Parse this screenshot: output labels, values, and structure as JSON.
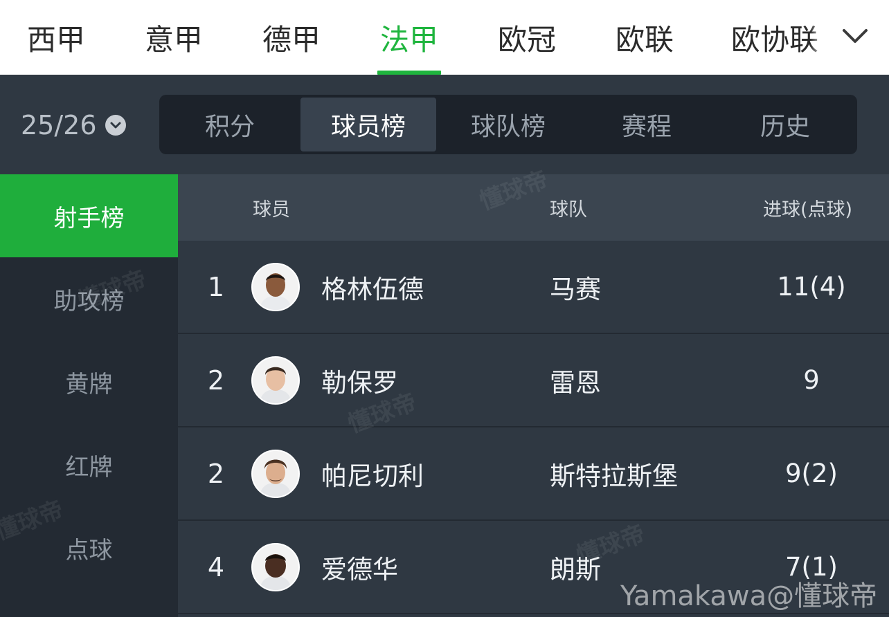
{
  "league_tabs": [
    {
      "label": "西甲",
      "active": false
    },
    {
      "label": "意甲",
      "active": false
    },
    {
      "label": "德甲",
      "active": false
    },
    {
      "label": "法甲",
      "active": true
    },
    {
      "label": "欧冠",
      "active": false
    },
    {
      "label": "欧联",
      "active": false
    },
    {
      "label": "欧协联",
      "active": false
    }
  ],
  "league_more_icon": "chevron-down-icon",
  "season": {
    "label": "25/26",
    "icon": "chevron-down-circle-icon"
  },
  "sub_tabs": [
    {
      "label": "积分",
      "active": false
    },
    {
      "label": "球员榜",
      "active": true
    },
    {
      "label": "球队榜",
      "active": false
    },
    {
      "label": "赛程",
      "active": false
    },
    {
      "label": "历史",
      "active": false
    }
  ],
  "categories": [
    {
      "label": "射手榜",
      "active": true
    },
    {
      "label": "助攻榜",
      "active": false
    },
    {
      "label": "黄牌",
      "active": false
    },
    {
      "label": "红牌",
      "active": false
    },
    {
      "label": "点球",
      "active": false
    }
  ],
  "table": {
    "headers": {
      "player": "球员",
      "team": "球队",
      "goals": "进球(点球)"
    },
    "rows": [
      {
        "rank": "1",
        "player": "格林伍德",
        "team": "马赛",
        "goals": "11(4)"
      },
      {
        "rank": "2",
        "player": "勒保罗",
        "team": "雷恩",
        "goals": "9"
      },
      {
        "rank": "2",
        "player": "帕尼切利",
        "team": "斯特拉斯堡",
        "goals": "9(2)"
      },
      {
        "rank": "4",
        "player": "爱德华",
        "team": "朗斯",
        "goals": "7(1)"
      }
    ]
  },
  "watermark": "懂球帝",
  "credit": "Yamakawa@懂球帝",
  "colors": {
    "accent": "#1fb53e",
    "background": "#2f3842",
    "header_bg": "#3b4550"
  }
}
